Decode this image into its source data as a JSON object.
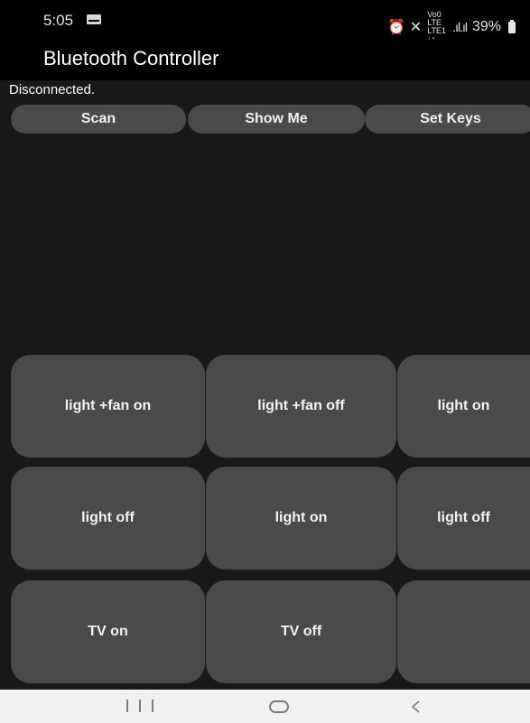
{
  "status_bar": {
    "time": "5:05",
    "right_glyphs": "⏰ ✕",
    "volte_lte": "Vo0 LTE LTE1 ↓↑",
    "signal": ".ıl.ıl",
    "battery": "39%"
  },
  "app_bar": {
    "title": "Bluetooth Controller"
  },
  "connection_status": "Disconnected.",
  "top_buttons": [
    "Scan",
    "Show Me",
    "Set Keys"
  ],
  "key_buttons": [
    "light +fan on",
    "light +fan off",
    "light on",
    "light off",
    "light on",
    "light off",
    "TV on",
    "TV off",
    ""
  ],
  "colors": {
    "background": "#181818",
    "button": "#4a4a4a",
    "bar": "#000000",
    "nav": "#f1f1f1"
  },
  "icons": [
    "message-icon",
    "alarm-icon",
    "mute-icon",
    "signal-icon",
    "battery-icon",
    "recents-icon",
    "home-icon",
    "back-icon"
  ]
}
